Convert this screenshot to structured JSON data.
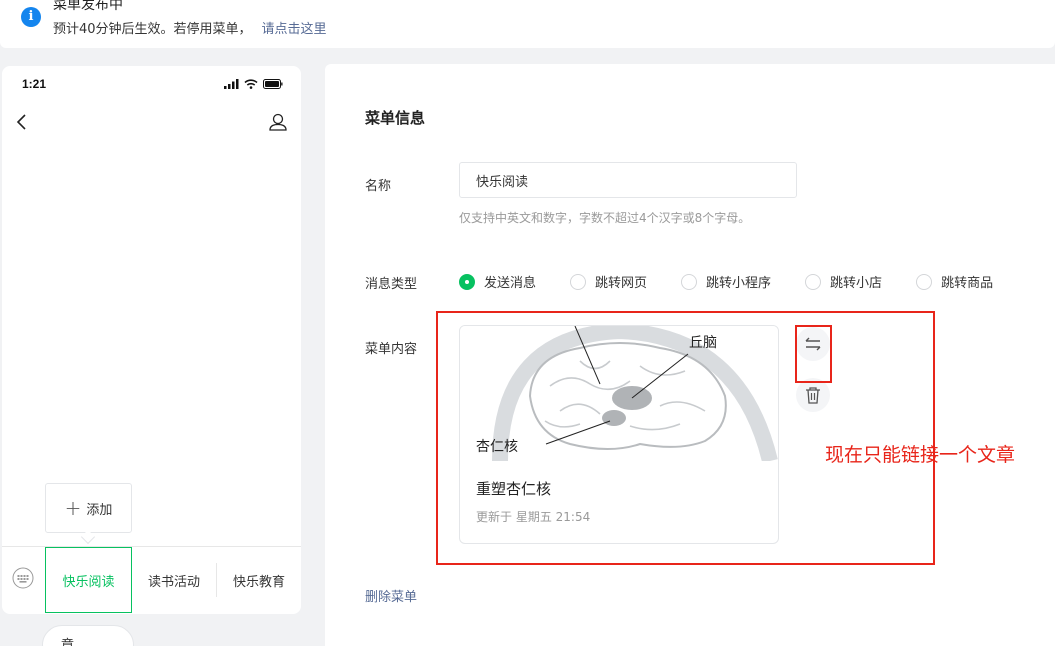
{
  "notice": {
    "title": "菜单发布中",
    "desc": "预计40分钟后生效。若停用菜单，",
    "link": "请点击这里"
  },
  "phone": {
    "time": "1:21",
    "add_label": "添加",
    "menu_items": [
      "快乐阅读",
      "读书活动",
      "快乐教育"
    ],
    "bottom_chip": "章"
  },
  "panel": {
    "title": "菜单信息",
    "name_label": "名称",
    "name_value": "快乐阅读",
    "name_hint": "仅支持中英文和数字，字数不超过4个汉字或8个字母。",
    "msg_type_label": "消息类型",
    "msg_types": [
      "发送消息",
      "跳转网页",
      "跳转小程序",
      "跳转小店",
      "跳转商品"
    ],
    "selected_msg_type": "发送消息",
    "content_label": "菜单内容",
    "article": {
      "title": "重塑杏仁核",
      "date": "更新于 星期五 21:54",
      "image_labels": [
        "丘脑",
        "杏仁核"
      ]
    },
    "delete_menu": "删除菜单"
  },
  "annotation": {
    "note": "现在只能链接一个文章"
  },
  "colors": {
    "accent": "#07c160",
    "link": "#576b95",
    "info": "#1485ee",
    "annotation": "#e8251a"
  }
}
